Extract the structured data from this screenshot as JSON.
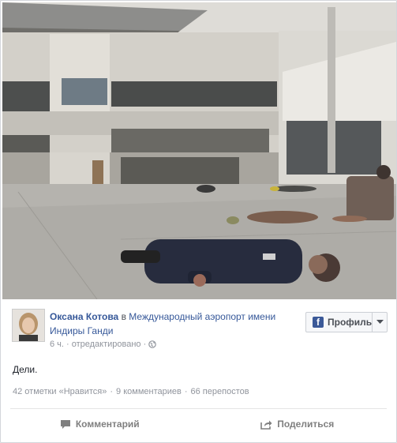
{
  "post": {
    "author": "Оксана Котова",
    "connector": "в",
    "place": "Международный аэропорт имени Индиры Ганди",
    "time": "6 ч.",
    "edited": "· отредактировано ·",
    "text": "Дели.",
    "image_alt": "Люди лежат на бетоне перед зданием аэропорта"
  },
  "profile_button": {
    "label": "Профиль",
    "icon": "facebook-logo-icon",
    "caret_icon": "caret-down-icon"
  },
  "stats": {
    "likes": "42 отметки «Нравится»",
    "comments": "9 комментариев",
    "shares": "66 перепостов",
    "separator": "·"
  },
  "actions": {
    "comment": {
      "label": "Комментарий",
      "icon": "comment-icon"
    },
    "share": {
      "label": "Поделиться",
      "icon": "share-icon"
    }
  },
  "colors": {
    "link": "#365899",
    "meta": "#90949c",
    "fb_blue": "#3b5998"
  }
}
